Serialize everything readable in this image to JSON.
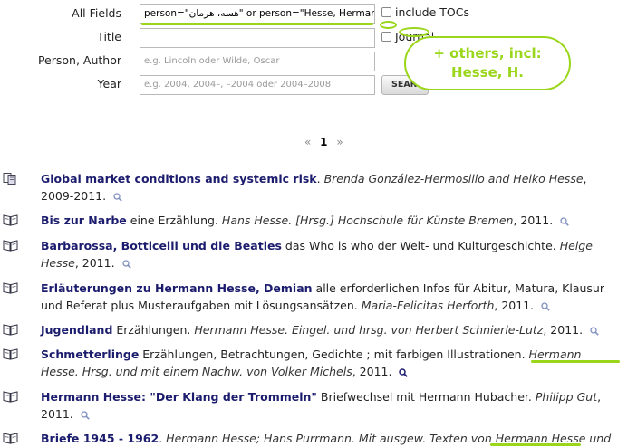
{
  "form": {
    "all_fields_label": "All Fields",
    "all_fields_value": "person=\"هسه، هرمان\" or person=\"Hesse, Herman",
    "title_label": "Title",
    "title_value": "",
    "person_label": "Person, Author",
    "person_placeholder": "e.g. Lincoln oder Wilde, Oscar",
    "year_label": "Year",
    "year_placeholder": "e.g. 2004, 2004–, –2004 oder 2004–2008",
    "include_tocs_label": "include TOCs",
    "journal_label": "Journal",
    "search_button": "SEARCH"
  },
  "annotation": {
    "cloud_line1": "+ others, incl:",
    "cloud_line2": "Hesse, H.",
    "color": "#9ad61a"
  },
  "pagination": {
    "prev": "«",
    "current": "1",
    "next": "»"
  },
  "results": [
    {
      "icon": "article-icon",
      "title": "Global market conditions and systemic risk",
      "rest": ".",
      "author": "Brenda González-Hermosillo and Heiko Hesse",
      "year": ", 2009-2011."
    },
    {
      "icon": "book-icon",
      "title": "Bis zur Narbe",
      "rest": " eine Erzählung.",
      "author": "Hans Hesse. [Hrsg.] Hochschule für Künste Bremen",
      "year": ", 2011."
    },
    {
      "icon": "book-icon",
      "title": "Barbarossa, Botticelli und die Beatles",
      "rest": " das Who is who der Welt- und Kulturgeschichte.",
      "author": "Helge Hesse",
      "year": ", 2011."
    },
    {
      "icon": "book-icon",
      "title": "Erläuterungen zu Hermann Hesse, Demian",
      "rest": " alle erforderlichen Infos für Abitur, Matura, Klausur und Referat plus Musteraufgaben mit Lösungsansätzen.",
      "author": "Maria-Felicitas Herforth",
      "year": ", 2011."
    },
    {
      "icon": "book-icon",
      "title": "Jugendland",
      "rest": " Erzählungen.",
      "author": "Hermann Hesse. Eingel. und hrsg. von Herbert Schnierle-Lutz",
      "year": ", 2011."
    },
    {
      "icon": "book-icon",
      "title": "Schmetterlinge",
      "rest": " Erzählungen, Betrachtungen, Gedichte ; mit farbigen Illustrationen.",
      "author": "Hermann Hesse. Hrsg. und mit einem Nachw. von Volker Michels",
      "year": ", 2011."
    },
    {
      "icon": "book-icon",
      "title": "Hermann Hesse: \"Der Klang der Trommeln\"",
      "rest": " Briefwechsel mit Hermann Hubacher.",
      "author": "Philipp Gut",
      "year": ", 2011."
    },
    {
      "icon": "book-icon",
      "title": "Briefe 1945 - 1962",
      "rest": ".",
      "author": "Hermann Hesse; Hans Purrmann. Mit ausgew. Texten von Hermann Hesse und",
      "year": ""
    }
  ]
}
